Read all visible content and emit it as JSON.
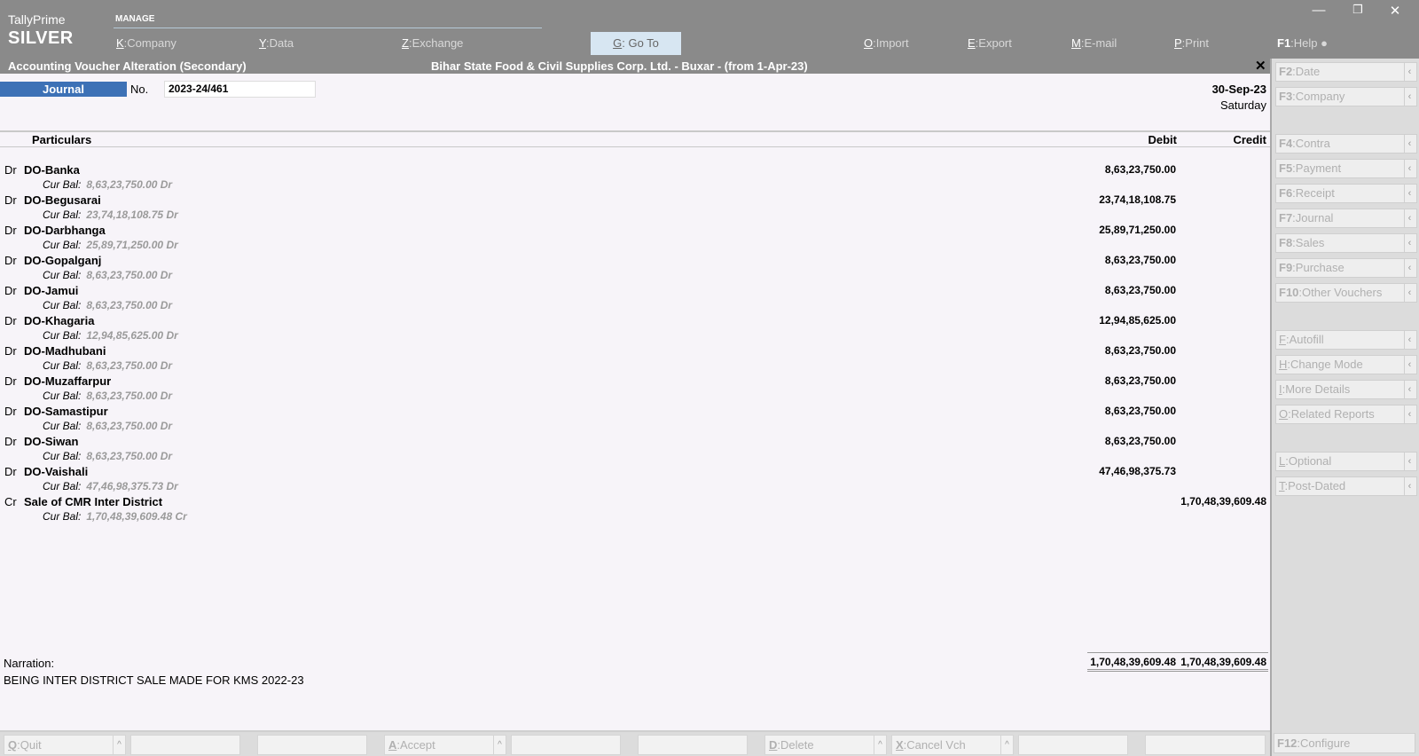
{
  "app": {
    "name": "TallyPrime",
    "edition": "SILVER",
    "section": "MANAGE"
  },
  "top_menu": [
    {
      "key": "K",
      "label": "Company"
    },
    {
      "key": "Y",
      "label": "Data"
    },
    {
      "key": "Z",
      "label": "Exchange"
    },
    {
      "key": "G",
      "label": "Go To"
    },
    {
      "key": "O",
      "label": "Import"
    },
    {
      "key": "E",
      "label": "Export"
    },
    {
      "key": "M",
      "label": "E-mail"
    },
    {
      "key": "P",
      "label": "Print"
    },
    {
      "key": "F1",
      "label": "Help"
    }
  ],
  "title": {
    "screen": "Accounting Voucher Alteration (Secondary)",
    "company": "Bihar State Food & Civil Supplies Corp. Ltd. - Buxar - (from 1-Apr-23)"
  },
  "voucher": {
    "type": "Journal",
    "no_label": "No.",
    "number": "2023-24/461",
    "date": "30-Sep-23",
    "day": "Saturday"
  },
  "columns": {
    "particulars": "Particulars",
    "debit": "Debit",
    "credit": "Credit"
  },
  "cur_bal_label": "Cur Bal:",
  "entries": [
    {
      "drcr": "Dr",
      "ledger": "DO-Banka",
      "debit": "8,63,23,750.00",
      "credit": "",
      "cur_bal": "8,63,23,750.00 Dr"
    },
    {
      "drcr": "Dr",
      "ledger": "DO-Begusarai",
      "debit": "23,74,18,108.75",
      "credit": "",
      "cur_bal": "23,74,18,108.75 Dr"
    },
    {
      "drcr": "Dr",
      "ledger": "DO-Darbhanga",
      "debit": "25,89,71,250.00",
      "credit": "",
      "cur_bal": "25,89,71,250.00 Dr"
    },
    {
      "drcr": "Dr",
      "ledger": "DO-Gopalganj",
      "debit": "8,63,23,750.00",
      "credit": "",
      "cur_bal": "8,63,23,750.00 Dr"
    },
    {
      "drcr": "Dr",
      "ledger": "DO-Jamui",
      "debit": "8,63,23,750.00",
      "credit": "",
      "cur_bal": "8,63,23,750.00 Dr"
    },
    {
      "drcr": "Dr",
      "ledger": "DO-Khagaria",
      "debit": "12,94,85,625.00",
      "credit": "",
      "cur_bal": "12,94,85,625.00 Dr"
    },
    {
      "drcr": "Dr",
      "ledger": "DO-Madhubani",
      "debit": "8,63,23,750.00",
      "credit": "",
      "cur_bal": "8,63,23,750.00 Dr"
    },
    {
      "drcr": "Dr",
      "ledger": "DO-Muzaffarpur",
      "debit": "8,63,23,750.00",
      "credit": "",
      "cur_bal": "8,63,23,750.00 Dr"
    },
    {
      "drcr": "Dr",
      "ledger": "DO-Samastipur",
      "debit": "8,63,23,750.00",
      "credit": "",
      "cur_bal": "8,63,23,750.00 Dr"
    },
    {
      "drcr": "Dr",
      "ledger": "DO-Siwan",
      "debit": "8,63,23,750.00",
      "credit": "",
      "cur_bal": "8,63,23,750.00 Dr"
    },
    {
      "drcr": "Dr",
      "ledger": "DO-Vaishali",
      "debit": "47,46,98,375.73",
      "credit": "",
      "cur_bal": "47,46,98,375.73 Dr"
    },
    {
      "drcr": "Cr",
      "ledger": "Sale of CMR Inter District",
      "debit": "",
      "credit": "1,70,48,39,609.48",
      "cur_bal": "1,70,48,39,609.48 Cr"
    }
  ],
  "narration": {
    "label": "Narration:",
    "text": "BEING INTER DISTRICT SALE MADE FOR KMS 2022-23"
  },
  "totals": {
    "debit": "1,70,48,39,609.48",
    "credit": "1,70,48,39,609.48"
  },
  "right_buttons": [
    {
      "key": "F2",
      "label": "Date"
    },
    {
      "key": "F3",
      "label": "Company"
    },
    {
      "key": "F4",
      "label": "Contra"
    },
    {
      "key": "F5",
      "label": "Payment"
    },
    {
      "key": "F6",
      "label": "Receipt"
    },
    {
      "key": "F7",
      "label": "Journal"
    },
    {
      "key": "F8",
      "label": "Sales"
    },
    {
      "key": "F9",
      "label": "Purchase"
    },
    {
      "key": "F10",
      "label": "Other Vouchers"
    },
    {
      "key": "F",
      "label": "Autofill"
    },
    {
      "key": "H",
      "label": "Change Mode"
    },
    {
      "key": "I",
      "label": "More Details"
    },
    {
      "key": "O",
      "label": "Related Reports"
    },
    {
      "key": "L",
      "label": "Optional"
    },
    {
      "key": "T",
      "label": "Post-Dated"
    }
  ],
  "bottom_buttons": [
    {
      "key": "Q",
      "label": "Quit"
    },
    {
      "key": "A",
      "label": "Accept"
    },
    {
      "key": "D",
      "label": "Delete"
    },
    {
      "key": "X",
      "label": "Cancel Vch"
    }
  ],
  "configure": {
    "key": "F12",
    "label": "Configure"
  }
}
